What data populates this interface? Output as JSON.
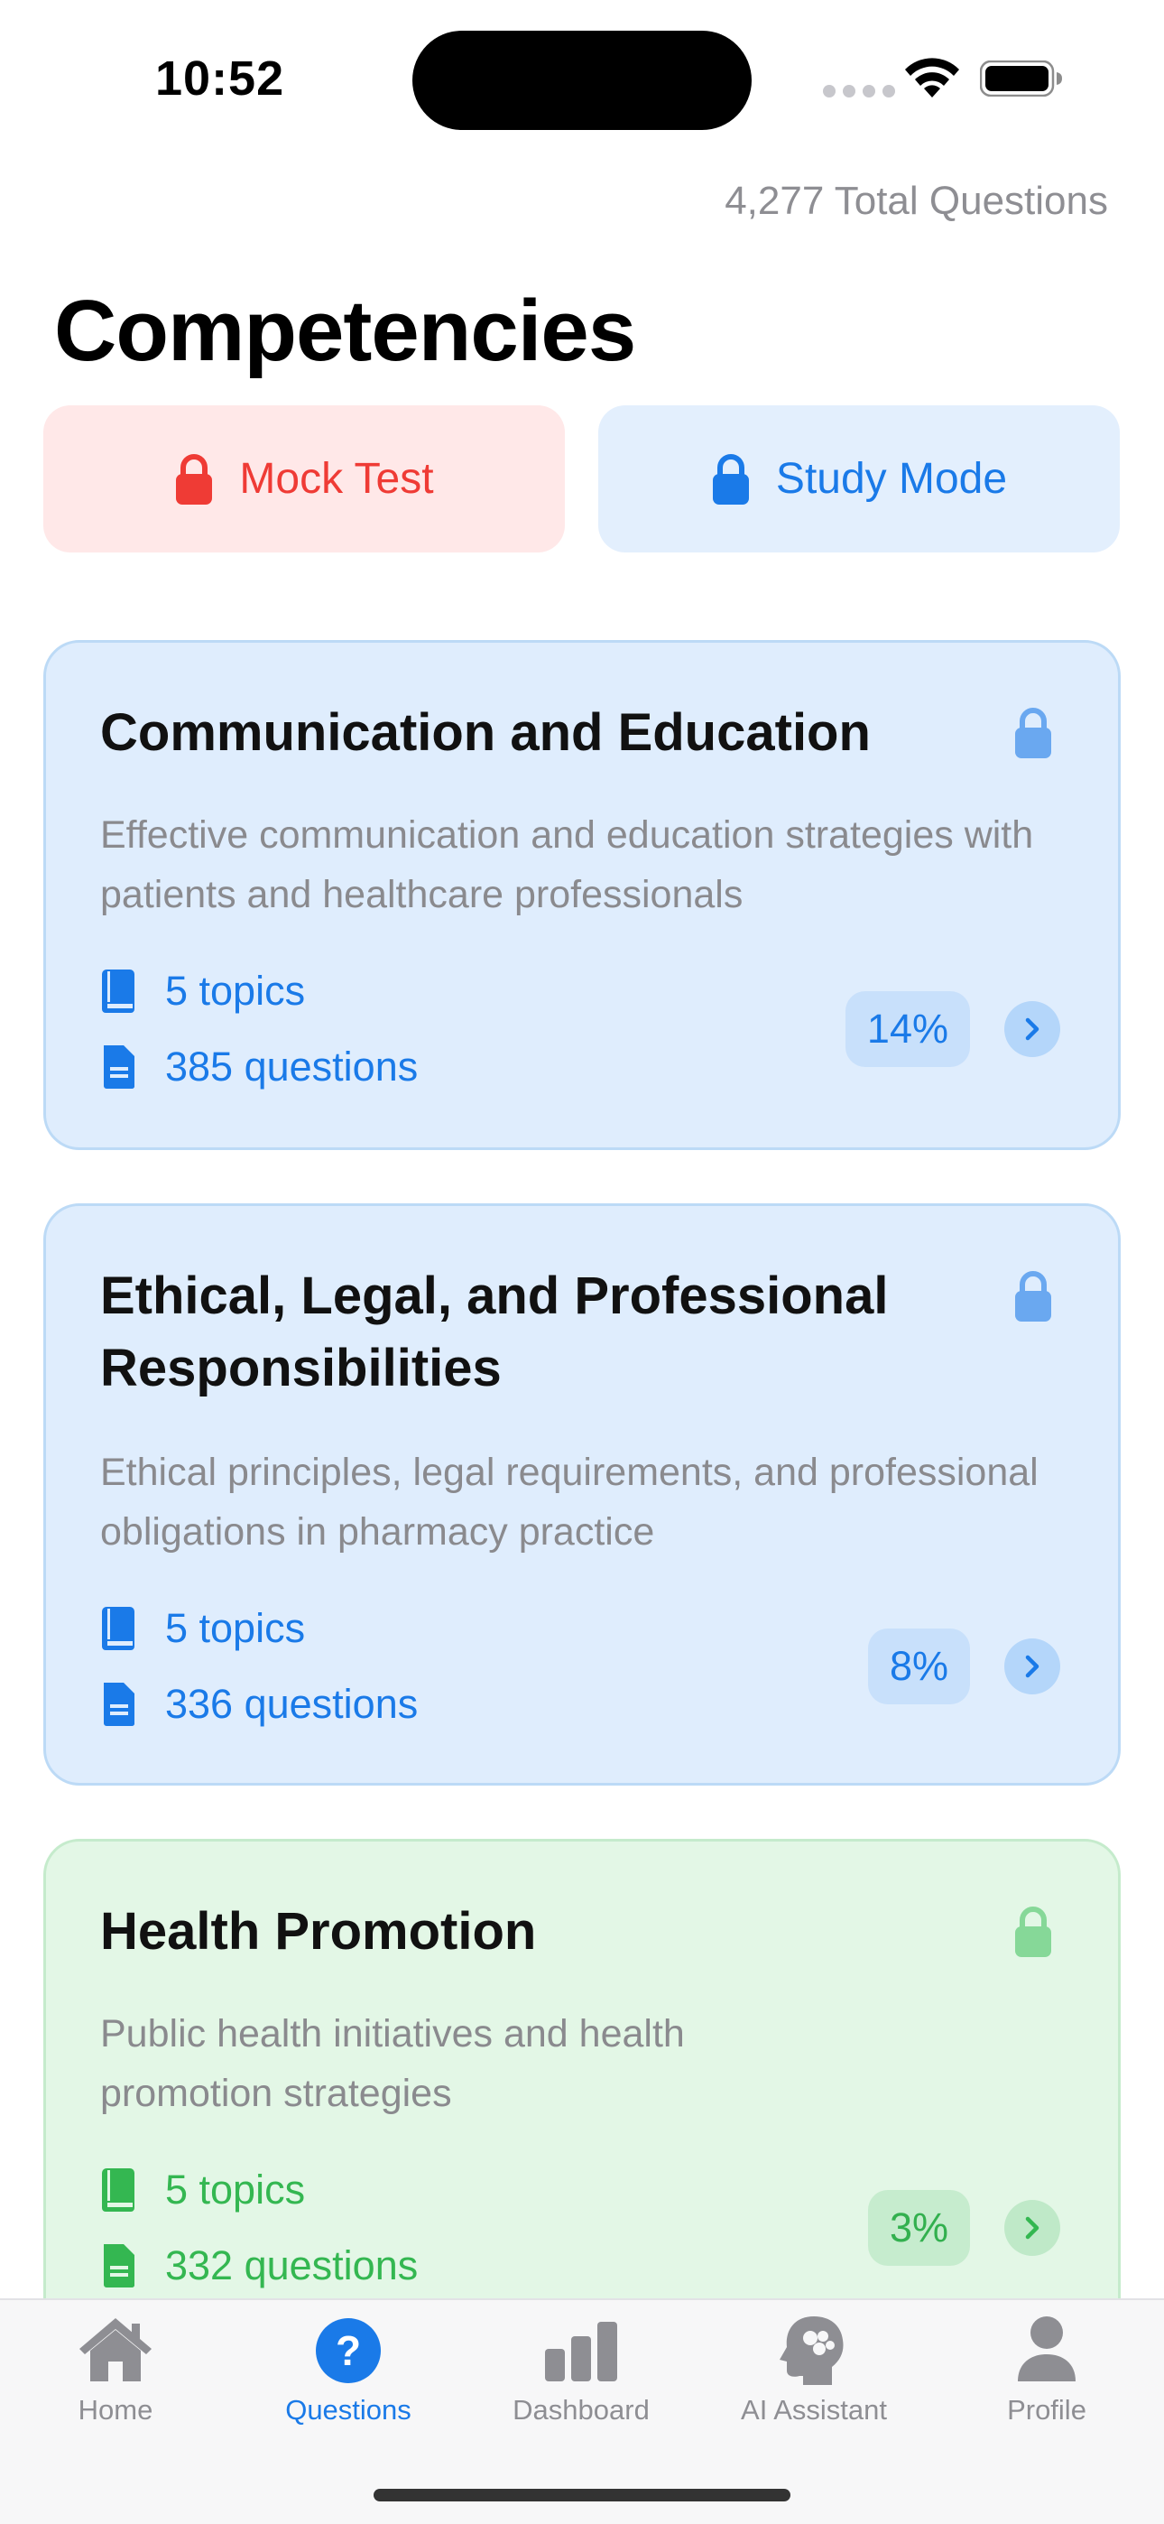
{
  "status_bar": {
    "time": "10:52"
  },
  "header": {
    "total_questions": "4,277 Total Questions",
    "title": "Competencies"
  },
  "modes": {
    "mock_test": "Mock Test",
    "study_mode": "Study Mode"
  },
  "colors": {
    "accent_blue": "#1a7ae8",
    "accent_red": "#ef3b35",
    "accent_green": "#34b751"
  },
  "cards": [
    {
      "title": "Communication and Education",
      "description": "Effective communication and education strategies with patients and healthcare professionals",
      "topics": "5 topics",
      "questions": "385 questions",
      "percent": "14%",
      "progress": 0.14
    },
    {
      "title": "Ethical, Legal, and Professional Responsibilities",
      "description": "Ethical principles, legal requirements, and professional obligations in pharmacy practice",
      "topics": "5 topics",
      "questions": "336 questions",
      "percent": "8%",
      "progress": 0.08
    },
    {
      "title": "Health Promotion",
      "description": "Public health initiatives and health promotion strategies",
      "topics": "5 topics",
      "questions": "332 questions",
      "percent": "3%",
      "progress": 0.03
    }
  ],
  "tabs": [
    {
      "label": "Home",
      "icon": "house-icon"
    },
    {
      "label": "Questions",
      "icon": "question-circle-icon",
      "active": true
    },
    {
      "label": "Dashboard",
      "icon": "bar-chart-icon"
    },
    {
      "label": "AI Assistant",
      "icon": "brain-head-icon"
    },
    {
      "label": "Profile",
      "icon": "person-icon"
    }
  ]
}
